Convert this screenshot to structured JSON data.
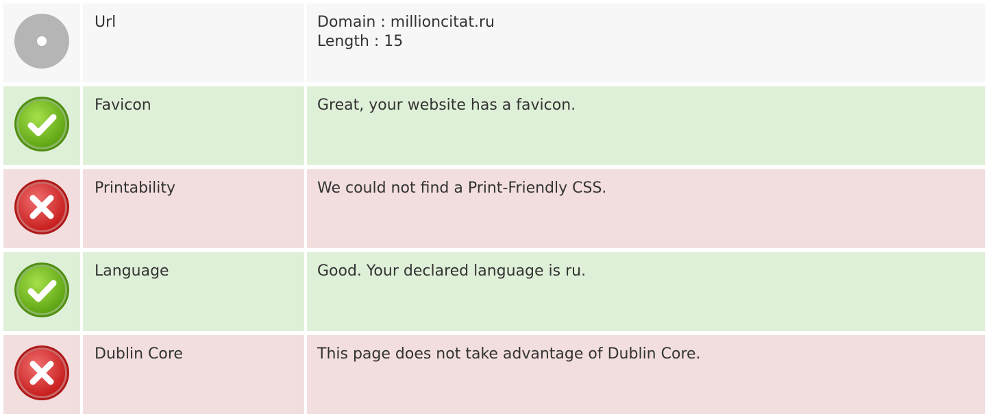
{
  "rows": [
    {
      "status": "neutral",
      "icon": "info-circle-icon",
      "label": "Url",
      "lines": [
        "Domain : millioncitat.ru",
        "Length : 15"
      ]
    },
    {
      "status": "pass",
      "icon": "check-circle-icon",
      "label": "Favicon",
      "lines": [
        "Great, your website has a favicon."
      ]
    },
    {
      "status": "fail",
      "icon": "cross-circle-icon",
      "label": "Printability",
      "lines": [
        "We could not find a Print-Friendly CSS."
      ]
    },
    {
      "status": "pass",
      "icon": "check-circle-icon",
      "label": "Language",
      "lines": [
        "Good. Your declared language is ru."
      ]
    },
    {
      "status": "fail",
      "icon": "cross-circle-icon",
      "label": "Dublin Core",
      "lines": [
        "This page does not take advantage of Dublin Core."
      ]
    }
  ],
  "colors": {
    "neutral_bg": "#f7f7f7",
    "pass_bg": "#dff0d8",
    "fail_bg": "#f2dede",
    "pass_icon": "#7cc521",
    "fail_icon": "#e23b3b",
    "neutral_icon": "#b5b5b5"
  }
}
